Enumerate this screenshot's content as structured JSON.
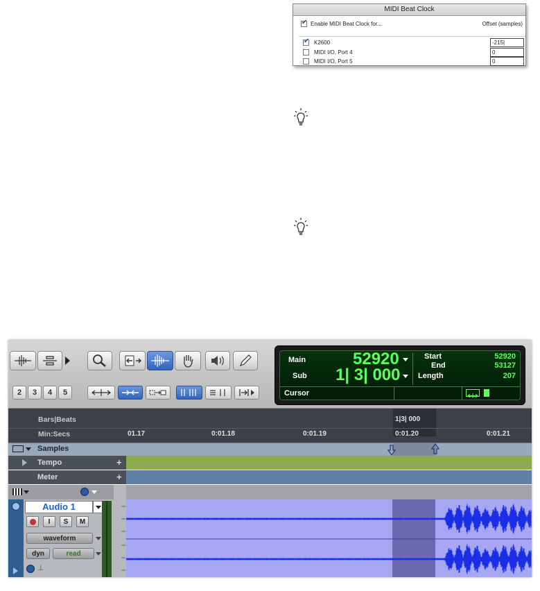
{
  "midi_dialog": {
    "title": "MIDI Beat Clock",
    "enable_label": "Enable MIDI Beat Clock for...",
    "offset_header": "Offset (samples)",
    "rows": [
      {
        "name": "K2600",
        "checked": true,
        "offset": "-215|"
      },
      {
        "name": "MIDI I/O, Port 4",
        "checked": false,
        "offset": "0"
      },
      {
        "name": "MIDI I/O, Port 5",
        "checked": false,
        "offset": "0"
      }
    ]
  },
  "tip_icons": [
    "lightbulb-icon",
    "lightbulb-icon"
  ],
  "toolbar": {
    "zoom_presets": [
      "2",
      "3",
      "4",
      "5"
    ],
    "tool_icons": [
      "zoomer-icon",
      "trim-icon",
      "selector-icon",
      "grabber-icon",
      "scrubber-icon",
      "pencil-icon"
    ]
  },
  "counter": {
    "main_label": "Main",
    "main_value": "52920",
    "sub_label": "Sub",
    "sub_value": "1| 3| 000",
    "start_label": "Start",
    "start_value": "52920",
    "end_label": "End",
    "end_value": "53127",
    "length_label": "Length",
    "length_value": "207",
    "cursor_label": "Cursor"
  },
  "rulers": {
    "bars_label": "Bars|Beats",
    "min_label": "Min:Secs",
    "bars_marker": "1|3| 000",
    "ticks": [
      "01.17",
      "0:01.18",
      "0:01.19",
      "0:01.20",
      "0:01.21"
    ]
  },
  "samples_label": "Samples",
  "conductor_rows": [
    {
      "name": "Tempo"
    },
    {
      "name": "Meter"
    }
  ],
  "track": {
    "name": "Audio 1",
    "buttons": [
      "I",
      "S",
      "M"
    ],
    "view": "waveform",
    "dyn_label": "dyn",
    "automation": "read"
  },
  "colors": {
    "counter_green": "#5bff5b",
    "tempo_lane": "#8cab4d",
    "meter_lane": "#607fa4",
    "track_bg": "#a6a6f3",
    "waveform": "#1a2ee6",
    "selection": "#6b6ab0"
  }
}
